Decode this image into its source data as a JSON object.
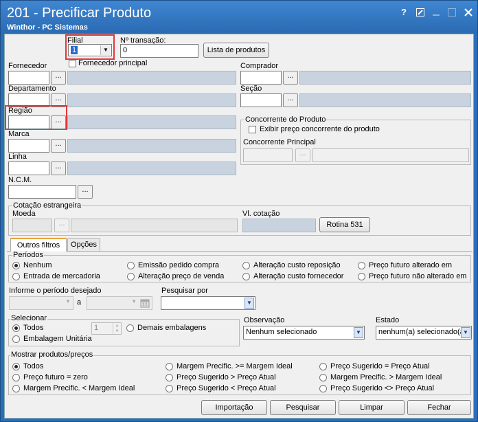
{
  "window": {
    "title": "201 - Precificar Produto",
    "subtitle": "Winthor - PC Sistemas",
    "help_glyph": "?"
  },
  "filial": {
    "label": "Filial",
    "value": "1"
  },
  "transacao": {
    "label": "Nº transação:",
    "value": "0"
  },
  "lista_button": "Lista de produtos",
  "fornecedor_principal": "Fornecedor principal",
  "fornecedor": {
    "label": "Fornecedor"
  },
  "comprador": {
    "label": "Comprador"
  },
  "departamento": {
    "label": "Departamento"
  },
  "secao": {
    "label": "Seção"
  },
  "regiao": {
    "label": "Região"
  },
  "marca": {
    "label": "Marca"
  },
  "linha": {
    "label": "Linha"
  },
  "ncm": {
    "label": "N.C.M."
  },
  "dots": "...",
  "concorrente": {
    "legend": "Concorrente do Produto",
    "exibir": "Exibir preço concorrente do produto",
    "principal": "Concorrente Principal"
  },
  "cotacao": {
    "legend": "Cotação estrangeira",
    "moeda": "Moeda",
    "vl": "Vl. cotação",
    "rotina_button": "Rotina 531"
  },
  "tabs": [
    {
      "label": "Outros filtros"
    },
    {
      "label": "Opções"
    }
  ],
  "periodos": {
    "legend": "Períodos",
    "options": [
      "Nenhum",
      "Emissão pedido compra",
      "Alteração custo reposição",
      "Preço futuro alterado em",
      "Entrada de mercadoria",
      "Alteração preço de venda",
      "Alteração custo fornecedor",
      "Preço futuro não alterado em"
    ]
  },
  "informe": {
    "label": "Informe o período desejado",
    "a": "a"
  },
  "pesquisar_por": {
    "label": "Pesquisar por"
  },
  "selecionar": {
    "legend": "Selecionar",
    "todos": "Todos",
    "unitaria": "Embalagem Unitária",
    "demais": "Demais embalagens",
    "qty": "1"
  },
  "observacao": {
    "label": "Observação",
    "value": "Nenhum selecionado"
  },
  "estado": {
    "label": "Estado",
    "value": "nenhum(a) selecionado(a)"
  },
  "mostrar": {
    "legend": "Mostrar produtos/preços",
    "options": [
      "Todos",
      "Margem Precific. >= Margem Ideal",
      "Preço Sugerido = Preço Atual",
      "Preço futuro = zero",
      "Preço Sugerido > Preço Atual",
      "Margem Precific. > Margem Ideal",
      "Margem Precific. < Margem Ideal",
      "Preço Sugerido < Preço Atual",
      "Preço Sugerido <> Preço Atual"
    ]
  },
  "buttons": {
    "importacao": "Importação",
    "pesquisar": "Pesquisar",
    "limpar": "Limpar",
    "fechar": "Fechar"
  },
  "colors": {
    "title_bar": "#2d6fb6",
    "highlight": "#e23838",
    "disabled_field": "#c8d3df"
  }
}
